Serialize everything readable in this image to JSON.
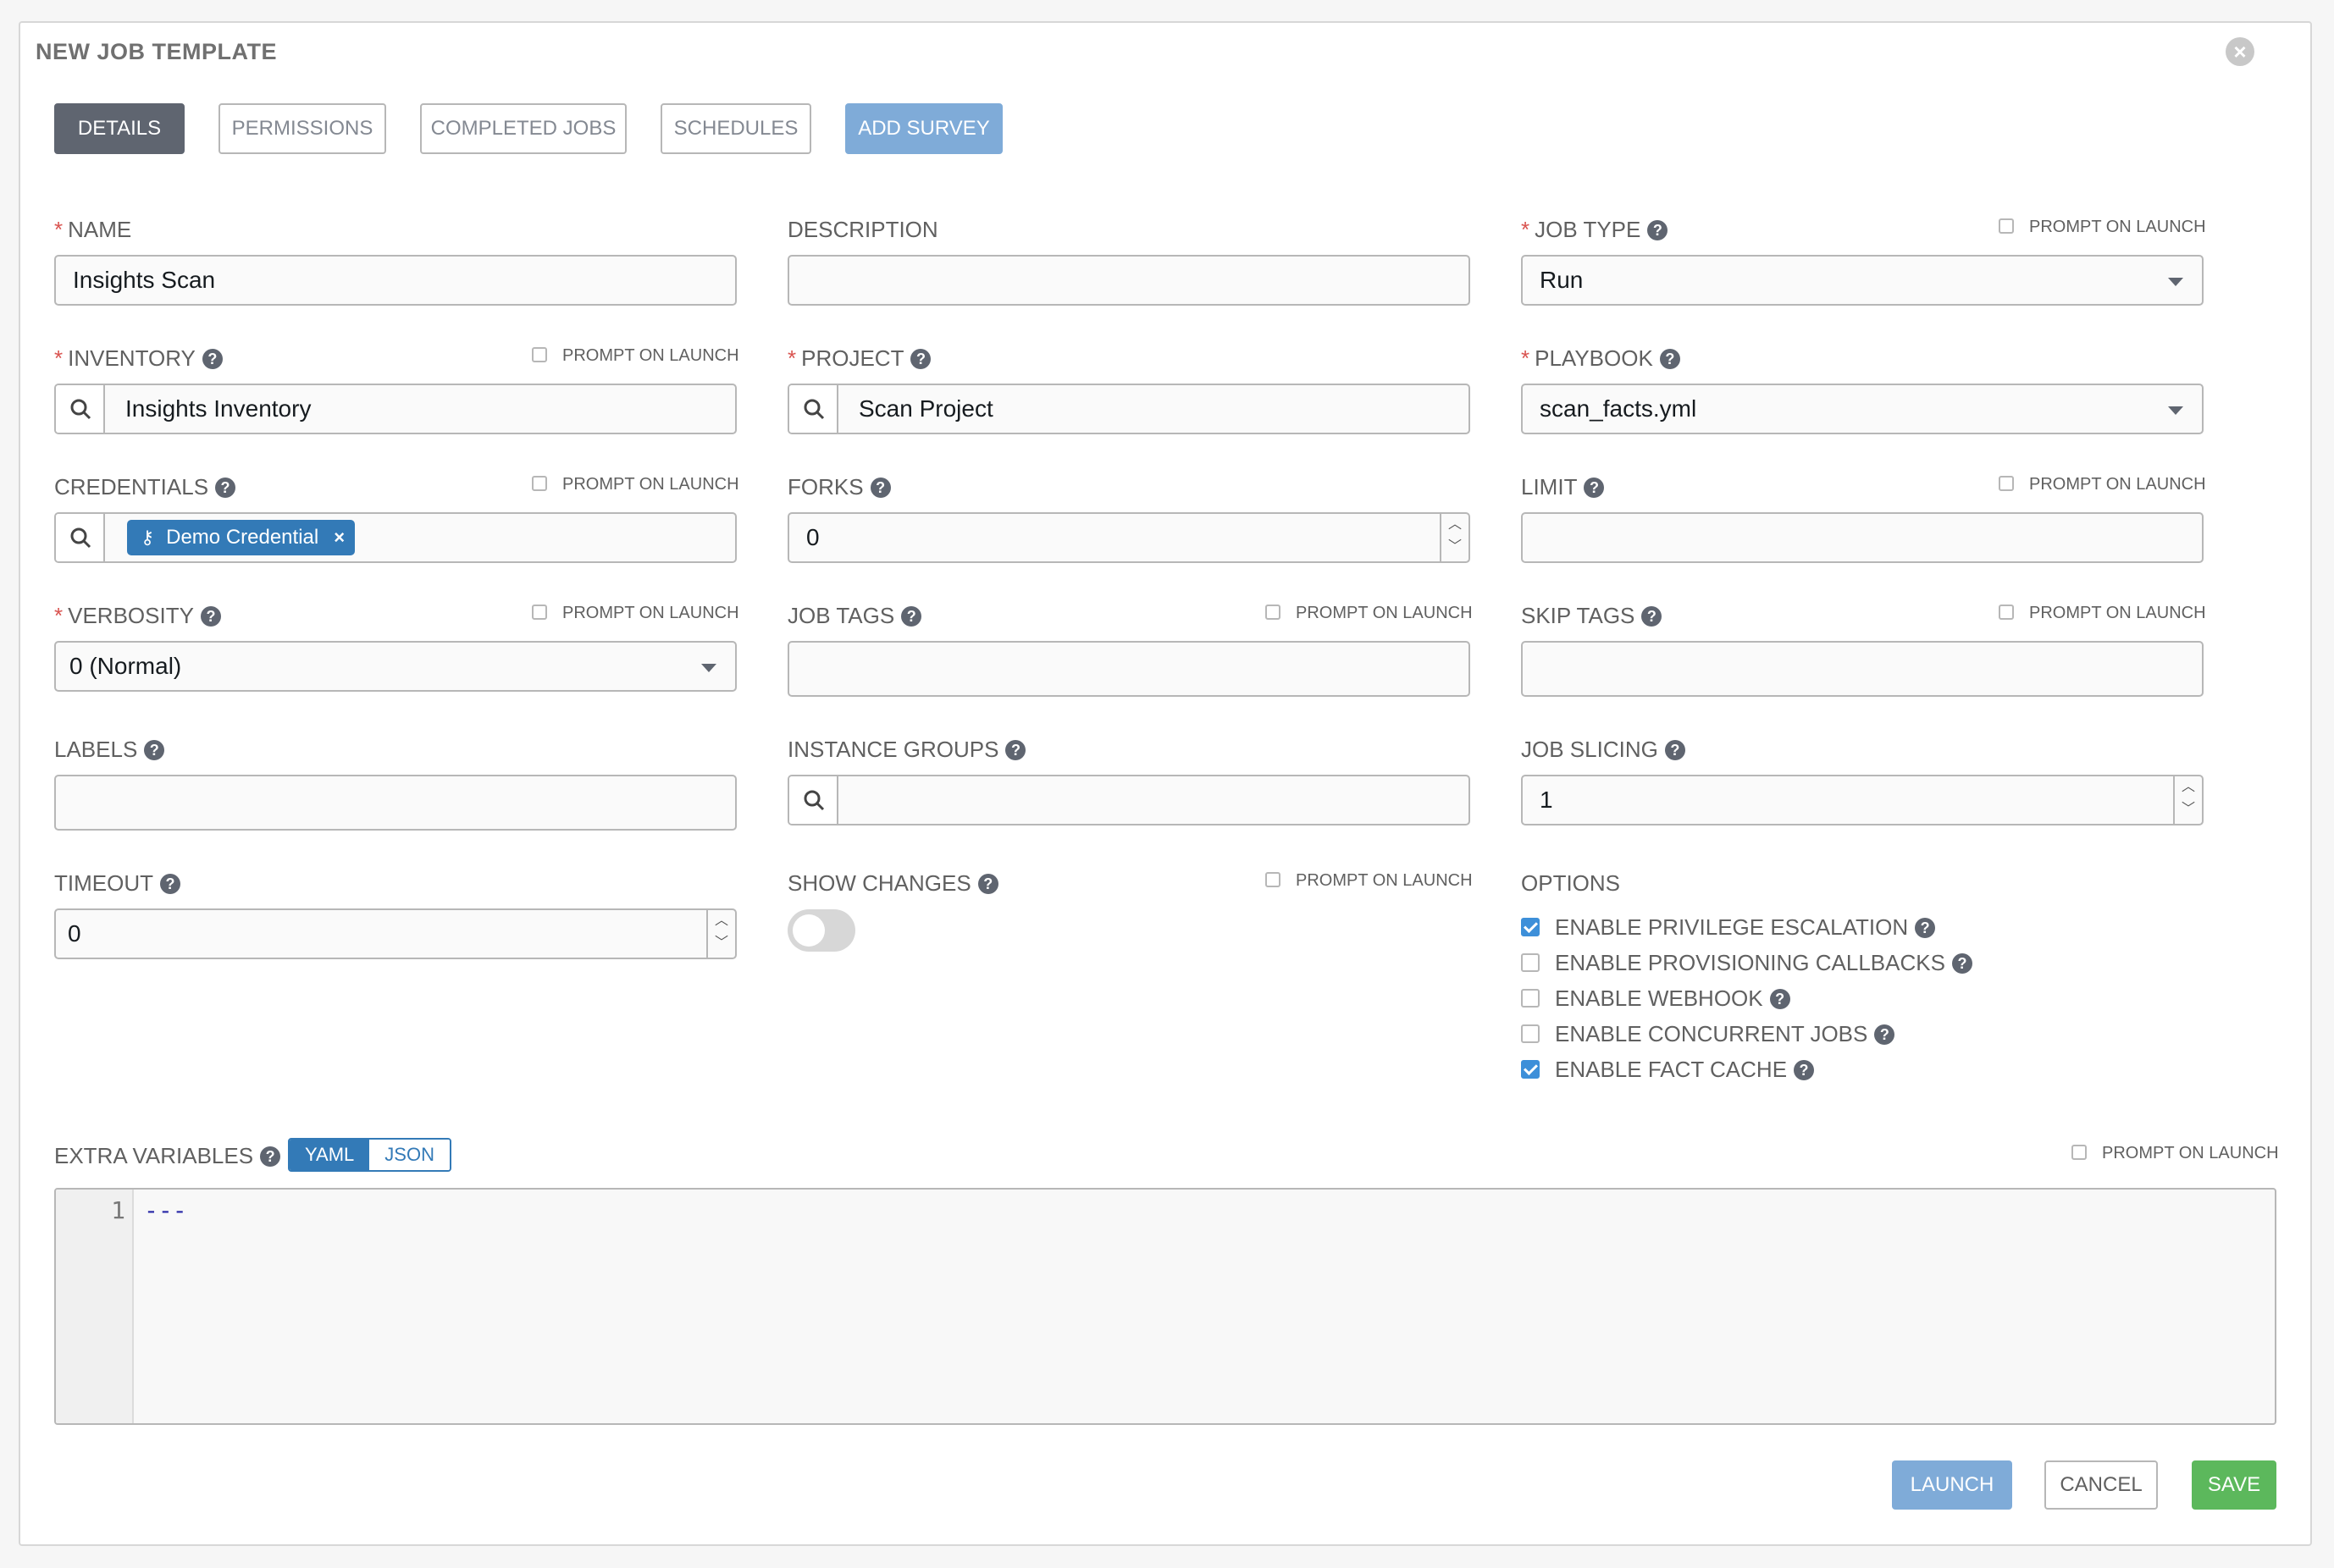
{
  "form": {
    "title": "NEW JOB TEMPLATE",
    "close_icon": "close-icon",
    "tabs": [
      "DETAILS",
      "PERMISSIONS",
      "COMPLETED JOBS",
      "SCHEDULES",
      "ADD SURVEY"
    ],
    "prompt_on_launch": "PROMPT ON LAUNCH"
  },
  "fields": {
    "name": {
      "label": "NAME",
      "value": "Insights Scan"
    },
    "description": {
      "label": "DESCRIPTION",
      "value": ""
    },
    "job_type": {
      "label": "JOB TYPE",
      "value": "Run"
    },
    "inventory": {
      "label": "INVENTORY",
      "value": "Insights Inventory"
    },
    "project": {
      "label": "PROJECT",
      "value": "Scan Project"
    },
    "playbook": {
      "label": "PLAYBOOK",
      "value": "scan_facts.yml"
    },
    "credentials": {
      "label": "CREDENTIALS",
      "chip": "Demo Credential"
    },
    "forks": {
      "label": "FORKS",
      "value": "0"
    },
    "limit": {
      "label": "LIMIT",
      "value": ""
    },
    "verbosity": {
      "label": "VERBOSITY",
      "value": "0 (Normal)"
    },
    "job_tags": {
      "label": "JOB TAGS",
      "value": ""
    },
    "skip_tags": {
      "label": "SKIP TAGS",
      "value": ""
    },
    "labels": {
      "label": "LABELS",
      "value": ""
    },
    "instance_groups": {
      "label": "INSTANCE GROUPS",
      "value": ""
    },
    "job_slicing": {
      "label": "JOB SLICING",
      "value": "1"
    },
    "timeout": {
      "label": "TIMEOUT",
      "value": "0"
    },
    "show_changes": {
      "label": "SHOW CHANGES",
      "enabled": false
    }
  },
  "options": {
    "label": "OPTIONS",
    "items": [
      {
        "label": "ENABLE PRIVILEGE ESCALATION",
        "checked": true
      },
      {
        "label": "ENABLE PROVISIONING CALLBACKS",
        "checked": false
      },
      {
        "label": "ENABLE WEBHOOK",
        "checked": false
      },
      {
        "label": "ENABLE CONCURRENT JOBS",
        "checked": false
      },
      {
        "label": "ENABLE FACT CACHE",
        "checked": true
      }
    ]
  },
  "extra_vars": {
    "label": "EXTRA VARIABLES",
    "modes": [
      "YAML",
      "JSON"
    ],
    "active_mode": "YAML",
    "line_number": "1",
    "content": "---"
  },
  "actions": {
    "launch": "LAUNCH",
    "cancel": "CANCEL",
    "save": "SAVE"
  },
  "colors": {
    "accent": "#337ab7",
    "save": "#5cb85c",
    "required": "#d9534f",
    "launch_disabled": "#7fabd8"
  }
}
